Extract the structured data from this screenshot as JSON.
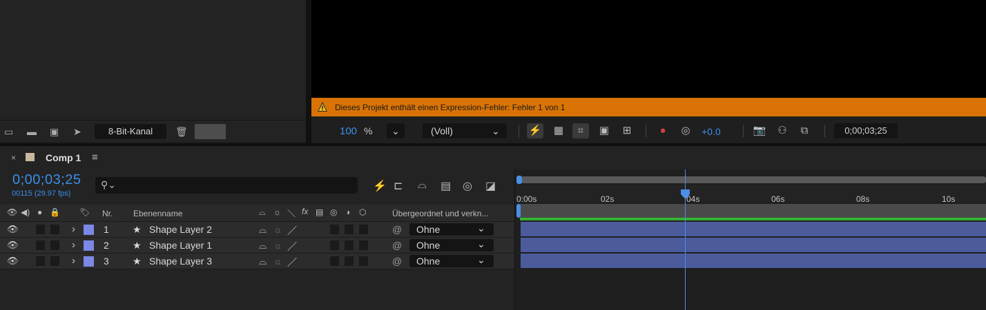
{
  "project_panel": {
    "bit_depth_label": "8-Bit-Kanal",
    "footer_icons": [
      "interpret-footage-icon",
      "new-folder-icon",
      "new-composition-icon",
      "render-queue-icon",
      "trash-icon"
    ]
  },
  "viewer": {
    "warning_text": "Dieses Projekt enthält einen Expression-Fehler: Fehler 1 von 1",
    "zoom_value": "100",
    "zoom_unit": "%",
    "resolution": "(Voll)",
    "exposure": "+0.0",
    "timecode": "0;00;03;25"
  },
  "timeline": {
    "tab_title": "Comp 1",
    "current_time": "0;00;03;25",
    "frame_info": "00115 (29.97 fps)",
    "search_placeholder": "",
    "columns": {
      "number": "Nr.",
      "layer_name": "Ebenenname",
      "parent": "Übergeordnet und verkn..."
    },
    "layers": [
      {
        "number": "1",
        "name": "Shape Layer 2",
        "parent": "Ohne"
      },
      {
        "number": "2",
        "name": "Shape Layer 1",
        "parent": "Ohne"
      },
      {
        "number": "3",
        "name": "Shape Layer 3",
        "parent": "Ohne"
      }
    ],
    "ruler_ticks": [
      "0:00s",
      "02s",
      "04s",
      "06s",
      "08s",
      "10s"
    ],
    "label_color": "#7b88e6",
    "playhead_color": "#4b8fe6",
    "layer_bar_color": "#4c5b9c"
  },
  "colors": {
    "warning_bar": "#d97306",
    "accent_blue": "#3d8ee8",
    "work_area_green": "#35b335"
  }
}
